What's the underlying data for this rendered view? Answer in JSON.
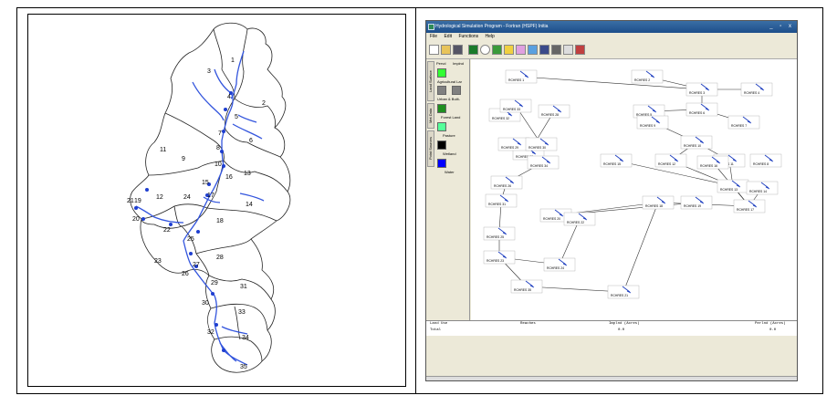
{
  "figure": {
    "subcatchment_labels": [
      "1",
      "2",
      "3",
      "4",
      "5",
      "6",
      "7",
      "8",
      "9",
      "10",
      "11",
      "12",
      "13",
      "14",
      "15",
      "16",
      "17",
      "18",
      "19",
      "20",
      "21",
      "22",
      "23",
      "24",
      "25",
      "26",
      "27",
      "28",
      "29",
      "30",
      "31",
      "32",
      "33",
      "34",
      "35"
    ]
  },
  "app": {
    "title": "Hydrological Simulation Program - Fortran (HSPF) Initia",
    "window_buttons": "_ ▫ x",
    "menu": [
      "File",
      "Edit",
      "Functions",
      "Help"
    ]
  },
  "legend": {
    "col_pervious": "Pervd",
    "col_impervious": "Implnd",
    "items": [
      {
        "label": "Agricultural Lar",
        "color": "#33ff33"
      },
      {
        "label": "Urban & Built-",
        "color": "#808080"
      },
      {
        "label": "Forest Land",
        "color": "#1f8f1f"
      },
      {
        "label": "Pasture",
        "color": "#55ff99"
      },
      {
        "label": "Wetland",
        "color": "#000000"
      },
      {
        "label": "Water",
        "color": "#0000ff"
      }
    ]
  },
  "vertical_tabs": [
    "Land Surface",
    "Met Data",
    "Point Sources"
  ],
  "reaches": [
    "RCHRES 1",
    "RCHRES 2",
    "RCHRES 3",
    "RCHRES 4",
    "RCHRES 5",
    "RCHRES 6",
    "RCHRES 7",
    "RCHRES 8",
    "RCHRES 9",
    "RCHRES 10",
    "RCHRES 11",
    "RCHRES 12",
    "RCHRES 13",
    "RCHRES 14",
    "RCHRES 15",
    "RCHRES 16",
    "RCHRES 17",
    "RCHRES 18",
    "RCHRES 19",
    "RCHRES 20",
    "RCHRES 21",
    "RCHRES 22",
    "RCHRES 23",
    "RCHRES 24",
    "RCHRES 25",
    "RCHRES 26",
    "RCHRES 27",
    "RCHRES 28",
    "RCHRES 29",
    "RCHRES 30",
    "RCHRES 31",
    "RCHRES 32",
    "RCHRES 33",
    "RCHRES 34",
    "RCHRES 35"
  ],
  "summary": {
    "headers": [
      "Land Use",
      "Reaches",
      "Implnd (Acres)",
      "Perlnd (Acres)"
    ],
    "row_label": "Total",
    "implnd_total": "0.0",
    "perlnd_total": "0.0"
  }
}
